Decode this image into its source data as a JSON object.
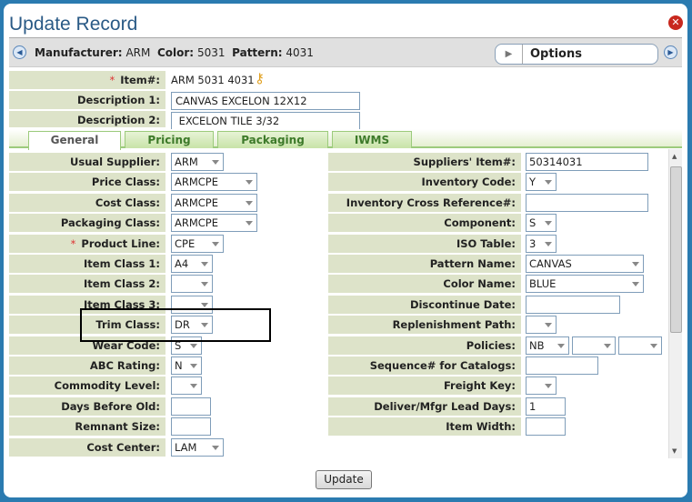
{
  "window": {
    "title": "Update Record",
    "close_icon": "close-icon"
  },
  "infobar": {
    "manufacturer_label": "Manufacturer:",
    "manufacturer": "ARM",
    "color_label": "Color:",
    "color": "5031",
    "pattern_label": "Pattern:",
    "pattern": "4031",
    "options_label": "Options"
  },
  "header": {
    "item_label": "Item#:",
    "item_value": "ARM 5031 4031",
    "key_icon": "key-icon",
    "desc1_label": "Description 1:",
    "desc1_value": "CANVAS EXCELON 12X12",
    "desc2_label": "Description 2:",
    "desc2_value": " EXCELON TILE 3/32"
  },
  "tabs": [
    {
      "label": "General",
      "active": true
    },
    {
      "label": "Pricing"
    },
    {
      "label": "Packaging"
    },
    {
      "label": "IWMS"
    }
  ],
  "left_fields": [
    {
      "label": "Usual Supplier:",
      "type": "select",
      "value": "ARM"
    },
    {
      "label": "Price Class:",
      "type": "select",
      "value": "ARMCPE"
    },
    {
      "label": "Cost Class:",
      "type": "select",
      "value": "ARMCPE"
    },
    {
      "label": "Packaging Class:",
      "type": "select",
      "value": "ARMCPE"
    },
    {
      "label": "Product Line:",
      "type": "select",
      "value": "CPE",
      "required": true
    },
    {
      "label": "Item Class 1:",
      "type": "select",
      "value": "A4"
    },
    {
      "label": "Item Class 2:",
      "type": "select",
      "value": ""
    },
    {
      "label": "Item Class 3:",
      "type": "select",
      "value": ""
    },
    {
      "label": "Trim Class:",
      "type": "select",
      "value": "DR"
    },
    {
      "label": "Wear Code:",
      "type": "select",
      "value": "S"
    },
    {
      "label": "ABC Rating:",
      "type": "select",
      "value": "N"
    },
    {
      "label": "Commodity Level:",
      "type": "select",
      "value": ""
    },
    {
      "label": "Days Before Old:",
      "type": "text",
      "value": ""
    },
    {
      "label": "Remnant Size:",
      "type": "text",
      "value": ""
    },
    {
      "label": "Cost Center:",
      "type": "select",
      "value": "LAM"
    },
    {
      "label": "",
      "type": "select",
      "value": ""
    }
  ],
  "right_fields": [
    {
      "label": "Suppliers' Item#:",
      "type": "text",
      "value": "50314031"
    },
    {
      "label": "Inventory Code:",
      "type": "select",
      "value": "Y"
    },
    {
      "label": "Inventory Cross Reference#:",
      "type": "text",
      "value": ""
    },
    {
      "label": "Component:",
      "type": "select",
      "value": "S"
    },
    {
      "label": "ISO Table:",
      "type": "select",
      "value": "3"
    },
    {
      "label": "Pattern Name:",
      "type": "select",
      "value": "CANVAS"
    },
    {
      "label": "Color Name:",
      "type": "select",
      "value": "BLUE"
    },
    {
      "label": "Discontinue Date:",
      "type": "text",
      "value": ""
    },
    {
      "label": "Replenishment Path:",
      "type": "select",
      "value": ""
    },
    {
      "label": "Policies:",
      "type": "multi-select",
      "values": [
        "NB",
        "",
        ""
      ]
    },
    {
      "label": "Sequence# for Catalogs:",
      "type": "text",
      "value": ""
    },
    {
      "label": "Freight Key:",
      "type": "select",
      "value": ""
    },
    {
      "label": "Deliver/Mfgr Lead Days:",
      "type": "text",
      "value": "1"
    },
    {
      "label": "Item Width:",
      "type": "text",
      "value": ""
    }
  ],
  "footer": {
    "update_label": "Update"
  }
}
